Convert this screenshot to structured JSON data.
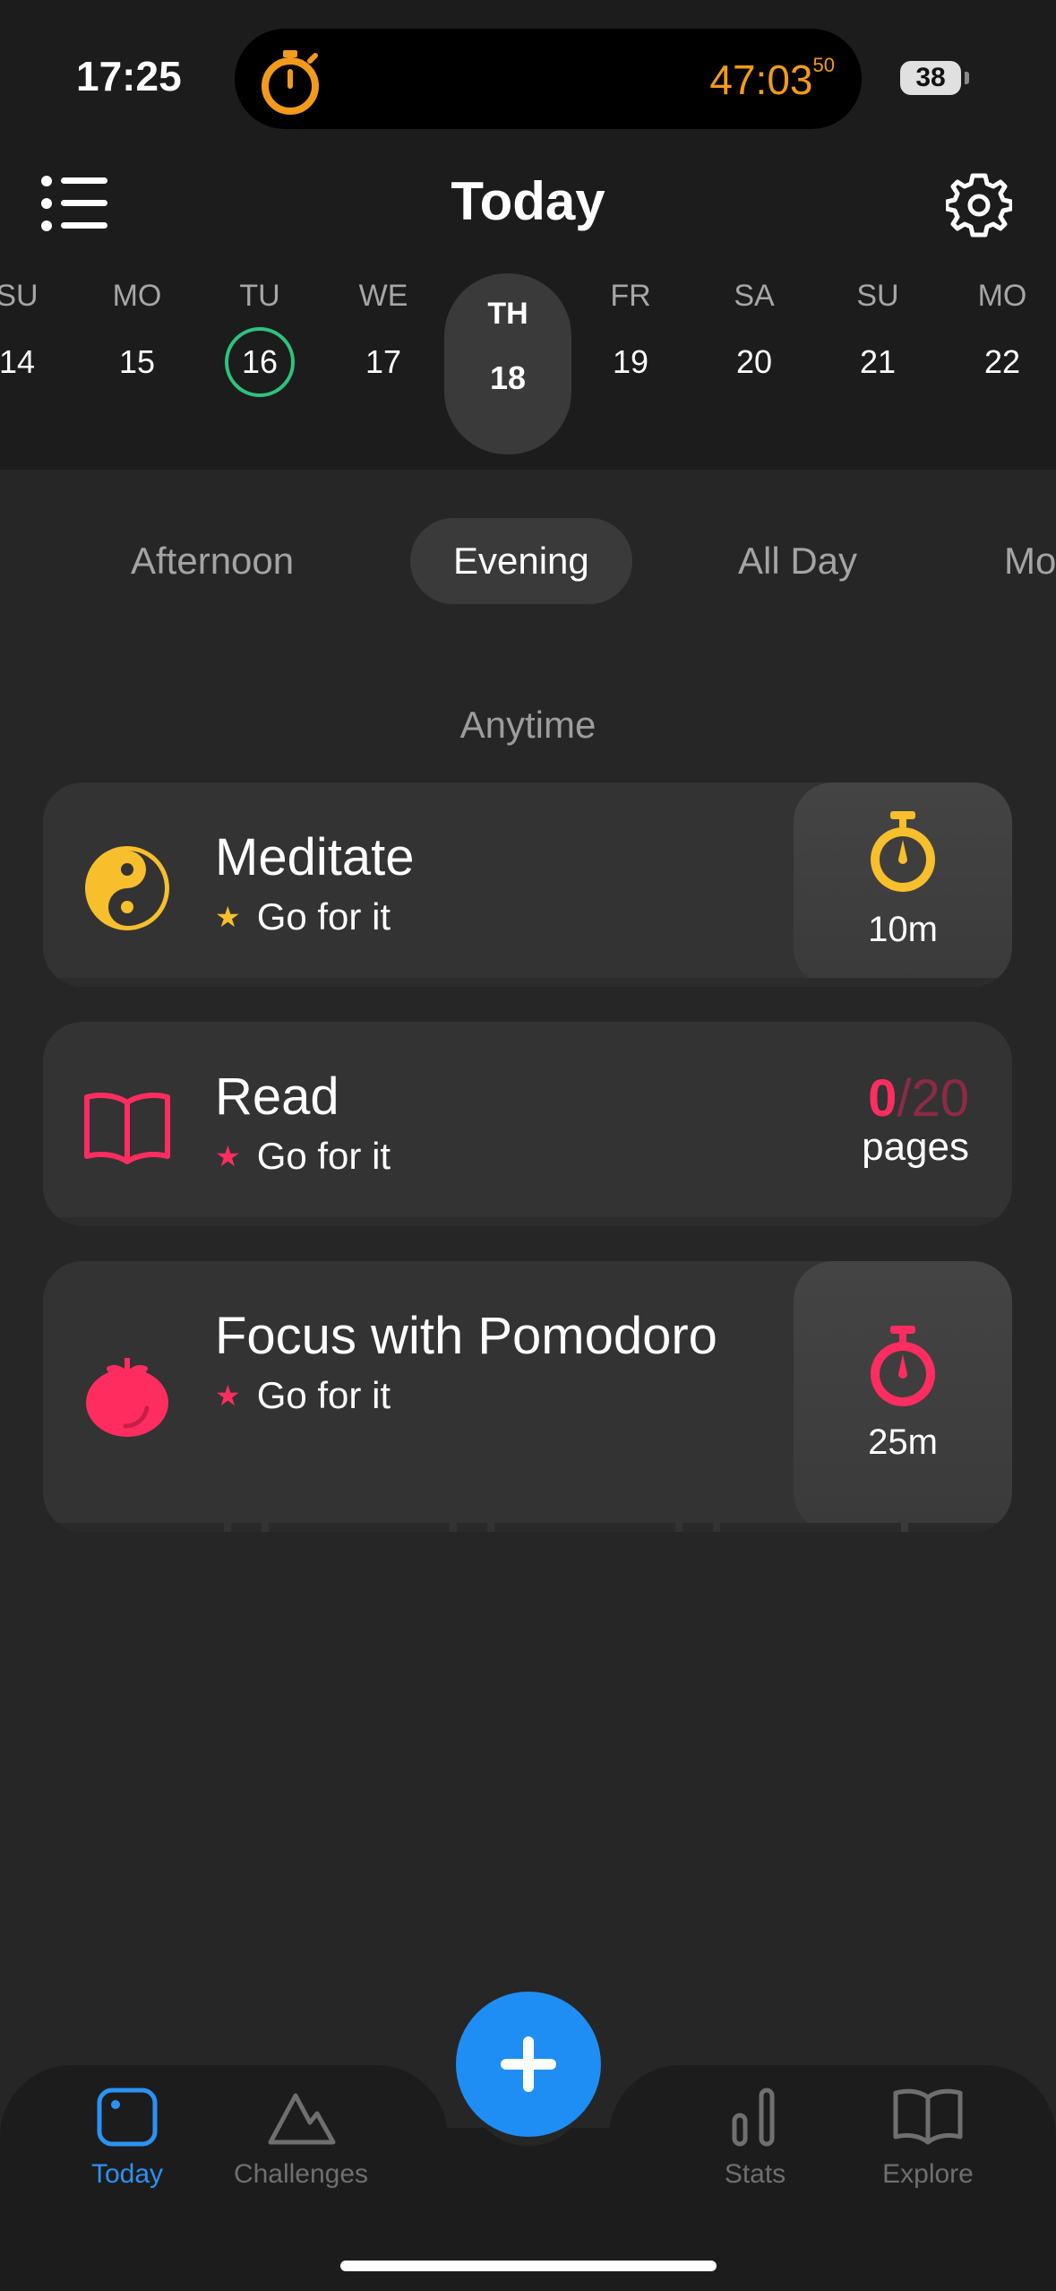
{
  "status": {
    "time": "17:25",
    "timer": "47:03",
    "timer_fraction": "50",
    "battery": "38"
  },
  "header": {
    "title": "Today"
  },
  "week": [
    {
      "dow": "SU",
      "num": "14"
    },
    {
      "dow": "MO",
      "num": "15"
    },
    {
      "dow": "TU",
      "num": "16",
      "today": true
    },
    {
      "dow": "WE",
      "num": "17"
    },
    {
      "dow": "TH",
      "num": "18",
      "selected": true
    },
    {
      "dow": "FR",
      "num": "19"
    },
    {
      "dow": "SA",
      "num": "20"
    },
    {
      "dow": "SU",
      "num": "21"
    },
    {
      "dow": "MO",
      "num": "22"
    }
  ],
  "segments": [
    "Afternoon",
    "Evening",
    "All Day",
    "Mo"
  ],
  "active_segment": "Evening",
  "section_label": "Anytime",
  "habits": [
    {
      "title": "Meditate",
      "subtitle": "Go for it",
      "icon": "yin-yang-icon",
      "color": "#f8bf2c",
      "action_label": "10m"
    },
    {
      "title": "Read",
      "subtitle": "Go for it",
      "icon": "book-icon",
      "color": "#ff2d5f",
      "progress_current": "0",
      "progress_total": "/20",
      "progress_unit": "pages"
    },
    {
      "title": "Focus with Pomodoro",
      "subtitle": "Go for it",
      "icon": "tomato-icon",
      "color": "#ff2d5f",
      "action_label": "25m"
    }
  ],
  "tabbar": {
    "today": "Today",
    "challenges": "Challenges",
    "stats": "Stats",
    "explore": "Explore"
  },
  "colors": {
    "accent": "#2b92f5",
    "today_ring": "#2ec27e",
    "timer": "#f29a1b"
  }
}
